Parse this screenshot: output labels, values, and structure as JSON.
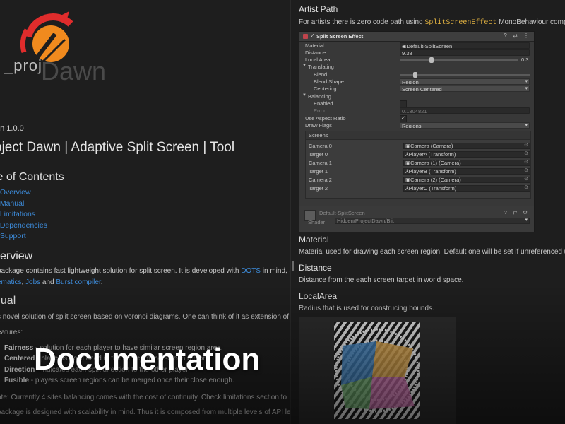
{
  "logo": {
    "proj": "_proj",
    "dawn": "Dawn",
    "colors": {
      "red": "#e02c2c",
      "orange": "#f08a1e"
    }
  },
  "version": "on 1.0.0",
  "title": "oject Dawn | Adaptive Split Screen | Tool",
  "toc": {
    "heading": "le of Contents",
    "items": [
      {
        "num": ".",
        "label": "Overview"
      },
      {
        "num": ".",
        "label": "Manual"
      },
      {
        "num": ".",
        "label": "Limitations"
      },
      {
        "num": ".",
        "label": "Dependencies"
      },
      {
        "num": ".",
        "label": "Support"
      }
    ]
  },
  "overview": {
    "heading": "verview",
    "line1_pre": "package contains fast lightweight solution for split screen. It is developed with ",
    "line1_link": "DOTS",
    "line1_post": " in mind, a",
    "line2_link1": "ematics",
    "line2_sep": ", ",
    "line2_link2": "Jobs",
    "line2_and": " and ",
    "line2_link3": "Burst compiler",
    "line2_end": "."
  },
  "manual": {
    "heading": "nual",
    "intro": "s novel solution of split screen based on voronoi diagrams. One can think of it as extension of",
    "features_label": "eatures:",
    "features": [
      {
        "name": "Fairness",
        "text": " - solution for each player to have similar screen region area."
      },
      {
        "name": "Centered",
        "text": " - player is positioned in the center of the screen region."
      },
      {
        "name": "Direction",
        "text": " - indicates each split direction to the other player."
      },
      {
        "name": "Fusible",
        "text": " - players screen regions can be merged once their close enough."
      }
    ],
    "note": "ote: Currently 4 sites balancing comes with the cost of continuity. Check limitations section fo",
    "scal": "package is designed with scalability in mind. Thus it is composed from multiple levels of API le"
  },
  "overlay_text": "Documentation",
  "artist": {
    "heading": "Artist Path",
    "line_pre": "For artists there is zero code path using ",
    "line_code": "SplitScreenEffect",
    "line_post": " MonoBehaviour componer"
  },
  "inspector": {
    "component_title": "Split Screen Effect",
    "header_tools": "? ⇄ ⋮",
    "rows": {
      "material_label": "Material",
      "material_value": "Default-SplitScreen",
      "distance_label": "Distance",
      "distance_value": "9.38",
      "local_area_label": "Local Area",
      "local_area_value": "0.3",
      "local_area_fraction": 0.27,
      "translating_label": "Translating",
      "blend_label": "Blend",
      "blend_fraction": 0.12,
      "blend_shape_label": "Blend Shape",
      "blend_shape_value": "Region",
      "centering_label": "Centering",
      "centering_value": "Screen Centered",
      "balancing_label": "Balancing",
      "enabled_label": "Enabled",
      "error_label": "Error",
      "error_value": "0.1304821",
      "aspect_label": "Use Aspect Ratio",
      "aspect_check": "✓",
      "draw_flags_label": "Draw Flags",
      "draw_flags_value": "Regions"
    },
    "screens_label": "Screens",
    "screens": [
      {
        "label": "Camera 0",
        "value": "Camera (Camera)"
      },
      {
        "label": "Target 0",
        "value": "PlayerA (Transform)"
      },
      {
        "label": "Camera 1",
        "value": "Camera (1) (Camera)"
      },
      {
        "label": "Target 1",
        "value": "PlayerB (Transform)"
      },
      {
        "label": "Camera 2",
        "value": "Camera (2) (Camera)"
      },
      {
        "label": "Target 2",
        "value": "PlayerC (Transform)"
      }
    ],
    "plus_minus": "+ −",
    "material_block": {
      "name": "Default-SplitScreen",
      "shader_label": "Shader",
      "shader_value": "Hidden/ProjectDawn/Blit",
      "tools": "? ⇄ ⚙"
    }
  },
  "sections": {
    "material_heading": "Material",
    "material_desc": "Material used for drawing each screen region. Default one will be set if unreferenced usin",
    "distance_heading": "Distance",
    "distance_desc": "Distance from the each screen target in world space.",
    "localarea_heading": "LocalArea",
    "localarea_desc": "Radius that is used for construcing bounds."
  }
}
